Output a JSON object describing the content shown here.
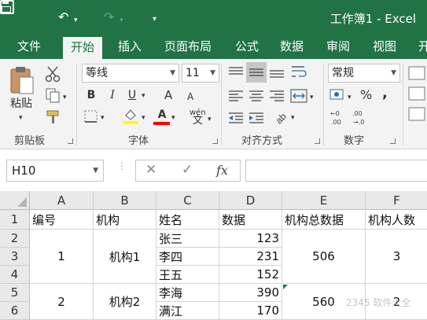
{
  "window": {
    "title": "工作簿1 - Excel"
  },
  "qat": {
    "undo_icon": "undo-icon",
    "redo_icon": "redo-icon",
    "customize": "▾"
  },
  "tabs": [
    {
      "label": "文件"
    },
    {
      "label": "开始",
      "active": true
    },
    {
      "label": "插入"
    },
    {
      "label": "页面布局"
    },
    {
      "label": "公式"
    },
    {
      "label": "数据"
    },
    {
      "label": "审阅"
    },
    {
      "label": "视图"
    },
    {
      "label": "开"
    }
  ],
  "ribbon": {
    "clipboard": {
      "label": "剪贴板",
      "paste_label": "粘贴"
    },
    "font": {
      "label": "字体",
      "font_name": "等线",
      "font_size": "11",
      "bold": "B",
      "italic": "I",
      "underline": "U",
      "grow": "A",
      "shrink": "A",
      "fill_color": "#ffff00",
      "font_color": "#ff0000",
      "phonetic": "wén"
    },
    "alignment": {
      "label": "对齐方式"
    },
    "number": {
      "label": "数字",
      "format": "常规",
      "percent": "%",
      "comma": ","
    }
  },
  "formula_bar": {
    "name_box": "H10",
    "cancel": "✕",
    "enter": "✓",
    "fx": "fx",
    "value": ""
  },
  "sheet": {
    "columns": [
      "A",
      "B",
      "C",
      "D",
      "E",
      "F"
    ],
    "rows": [
      "1",
      "2",
      "3",
      "4",
      "5",
      "6"
    ],
    "headers": [
      "编号",
      "机构",
      "姓名",
      "数据",
      "机构总数据",
      "机构人数"
    ],
    "groups": [
      {
        "id": "1",
        "org": "机构1",
        "total": "506",
        "count": "3",
        "members": [
          {
            "name": "张三",
            "value": "123"
          },
          {
            "name": "李四",
            "value": "231"
          },
          {
            "name": "王五",
            "value": "152"
          }
        ]
      },
      {
        "id": "2",
        "org": "机构2",
        "total": "560",
        "count": "2",
        "members": [
          {
            "name": "李海",
            "value": "390"
          },
          {
            "name": "满江",
            "value": "170"
          }
        ]
      }
    ]
  },
  "watermark": "2345 软件大全"
}
